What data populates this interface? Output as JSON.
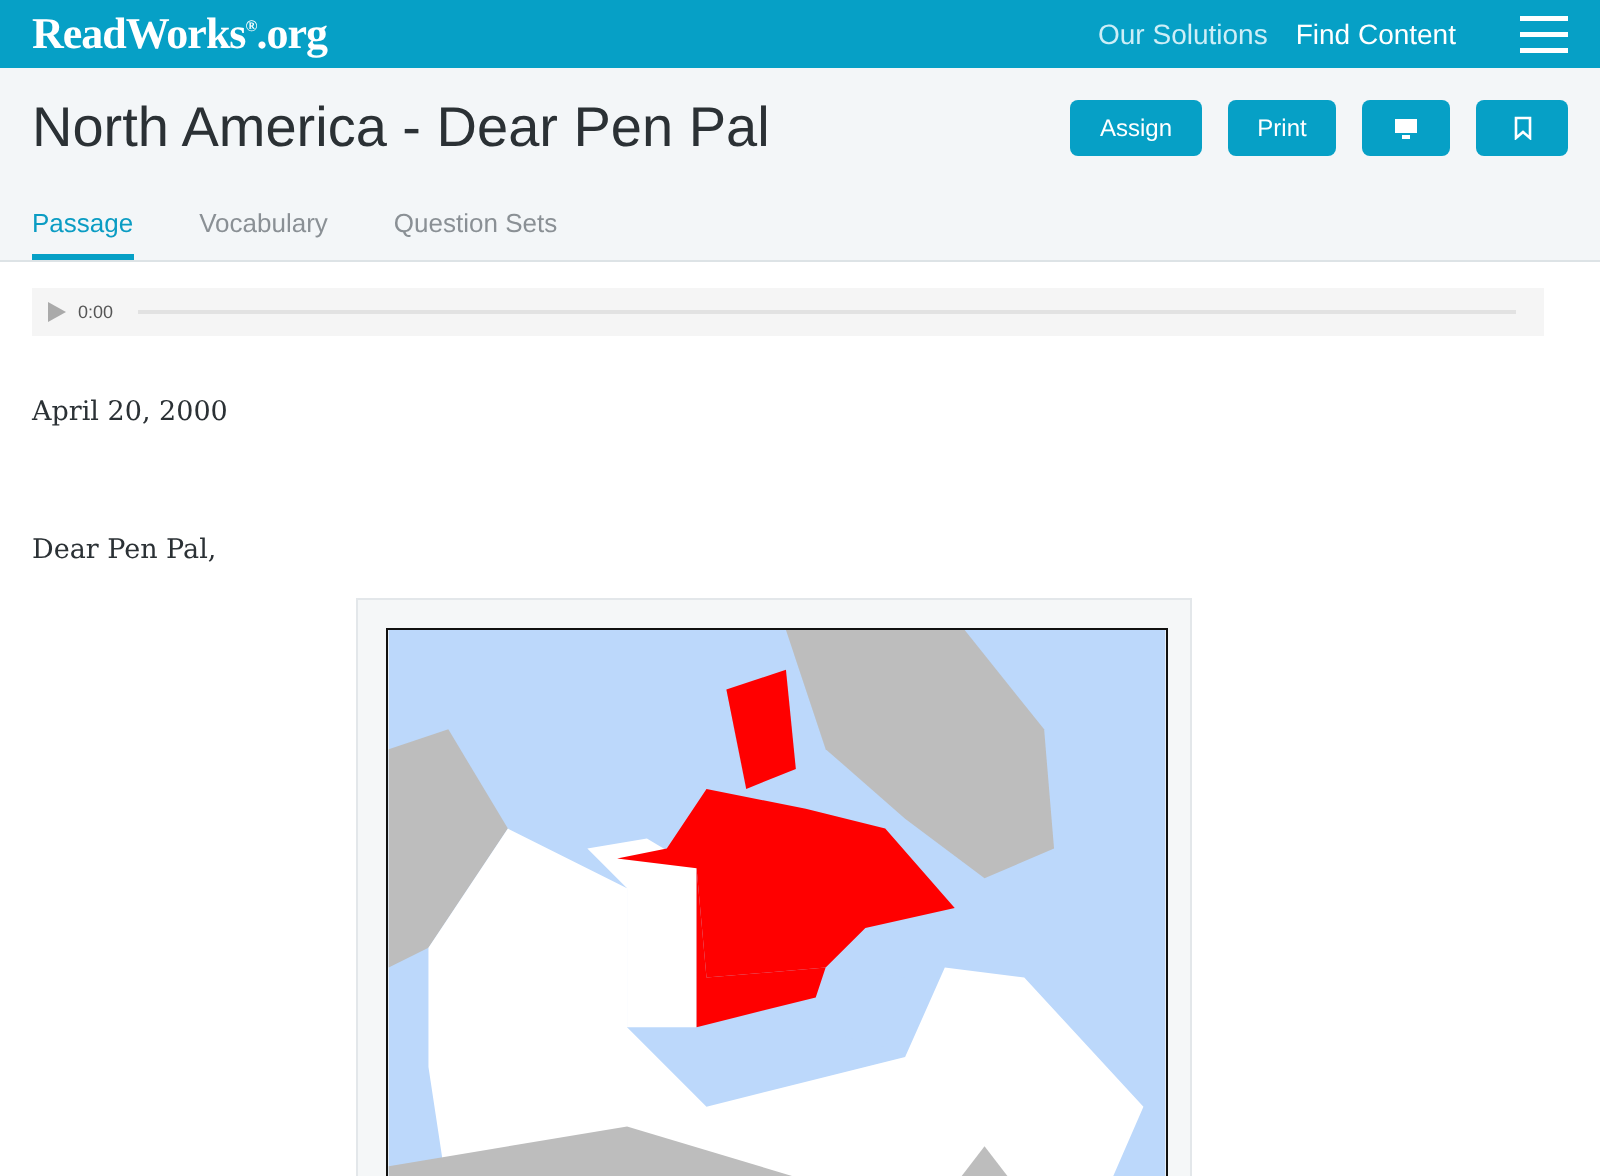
{
  "header": {
    "logo": "ReadWorks$^{®}$.org",
    "nav": [
      {
        "label": "Our Solutions",
        "selected": false
      },
      {
        "label": "Find Content",
        "selected": true
      }
    ]
  },
  "title": "North America - Dear Pen Pal",
  "actions": [
    {
      "kind": "text",
      "label": "Assign"
    },
    {
      "kind": "text",
      "label": "Print"
    },
    {
      "kind": "monitor"
    },
    {
      "kind": "bookmark"
    }
  ],
  "tabs": [
    {
      "label": "Passage",
      "selected": true
    },
    {
      "label": "Vocabulary",
      "selected": false
    },
    {
      "label": "Question Sets",
      "selected": false
    }
  ],
  "audio": {
    "time": "0:00"
  },
  "passage": [
    "April 20, 2000",
    "Dear Pen Pal,"
  ],
  "figure": {
    "kind": "picture"
  }
}
